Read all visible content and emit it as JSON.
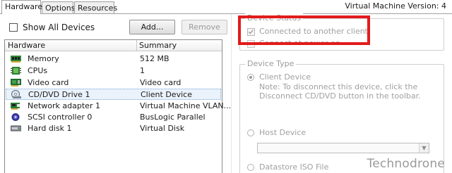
{
  "tabs": [
    {
      "label": "Hardware",
      "active": true
    },
    {
      "label": "Options",
      "active": false
    },
    {
      "label": "Resources",
      "active": false
    }
  ],
  "vm_version": "Virtual Machine Version: 4",
  "show_all_devices": {
    "label": "Show All Devices",
    "checked": false
  },
  "buttons": {
    "add": "Add...",
    "remove": "Remove"
  },
  "hardware_table": {
    "columns": [
      "Hardware",
      "Summary"
    ],
    "rows": [
      {
        "icon": "memory-icon",
        "name": "Memory",
        "summary": "512 MB"
      },
      {
        "icon": "cpu-icon",
        "name": "CPUs",
        "summary": "1"
      },
      {
        "icon": "video-card-icon",
        "name": "Video card",
        "summary": "Video card"
      },
      {
        "icon": "cd-dvd-icon",
        "name": "CD/DVD Drive 1",
        "summary": "Client Device",
        "selected": true
      },
      {
        "icon": "network-adapter-icon",
        "name": "Network adapter 1",
        "summary": "Virtual Machine VLAN..."
      },
      {
        "icon": "scsi-controller-icon",
        "name": "SCSI controller 0",
        "summary": "BusLogic Parallel"
      },
      {
        "icon": "hard-disk-icon",
        "name": "Hard disk 1",
        "summary": "Virtual Disk"
      }
    ]
  },
  "device_status": {
    "title": "Device Status",
    "connected": {
      "label": "Connected to another client",
      "checked": true
    },
    "connect_at_power_on": {
      "label": "Connect at power on",
      "checked": false
    }
  },
  "device_type": {
    "title": "Device Type",
    "client_device": {
      "label": "Client Device",
      "selected": true,
      "note": "Note: To disconnect this device, click the Disconnect CD/DVD button in the toolbar."
    },
    "host_device": {
      "label": "Host Device",
      "selected": false,
      "value": ""
    },
    "datastore_iso": {
      "label": "Datastore ISO File",
      "selected": false
    }
  },
  "watermark": "Technodrone",
  "colors": {
    "highlight_box": "#e21b1b",
    "selection_bg": "#eaf2fc"
  }
}
